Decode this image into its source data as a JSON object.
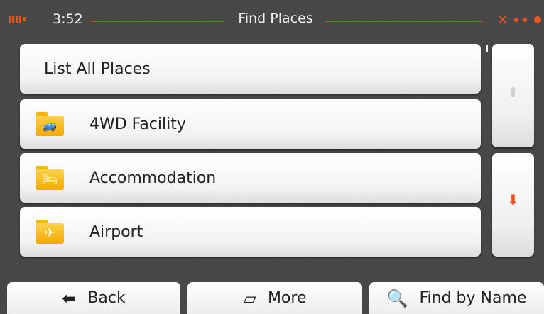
{
  "status": {
    "time": "3:52",
    "title": "Find Places",
    "battery_icon": "battery-icon",
    "gps_icon": "satellite-icon",
    "accent_color": "#e8541e"
  },
  "list": {
    "items": [
      {
        "label": "List All Places",
        "icon": null
      },
      {
        "label": "4WD Facility",
        "icon": "jeep-icon"
      },
      {
        "label": "Accommodation",
        "icon": "bed-icon"
      },
      {
        "label": "Airport",
        "icon": "airplane-icon"
      }
    ]
  },
  "scroll": {
    "up_icon": "scroll-up-arrow-icon",
    "down_icon": "scroll-down-arrow-icon"
  },
  "bottom": {
    "back_label": "Back",
    "more_label": "More",
    "find_label": "Find by Name"
  }
}
